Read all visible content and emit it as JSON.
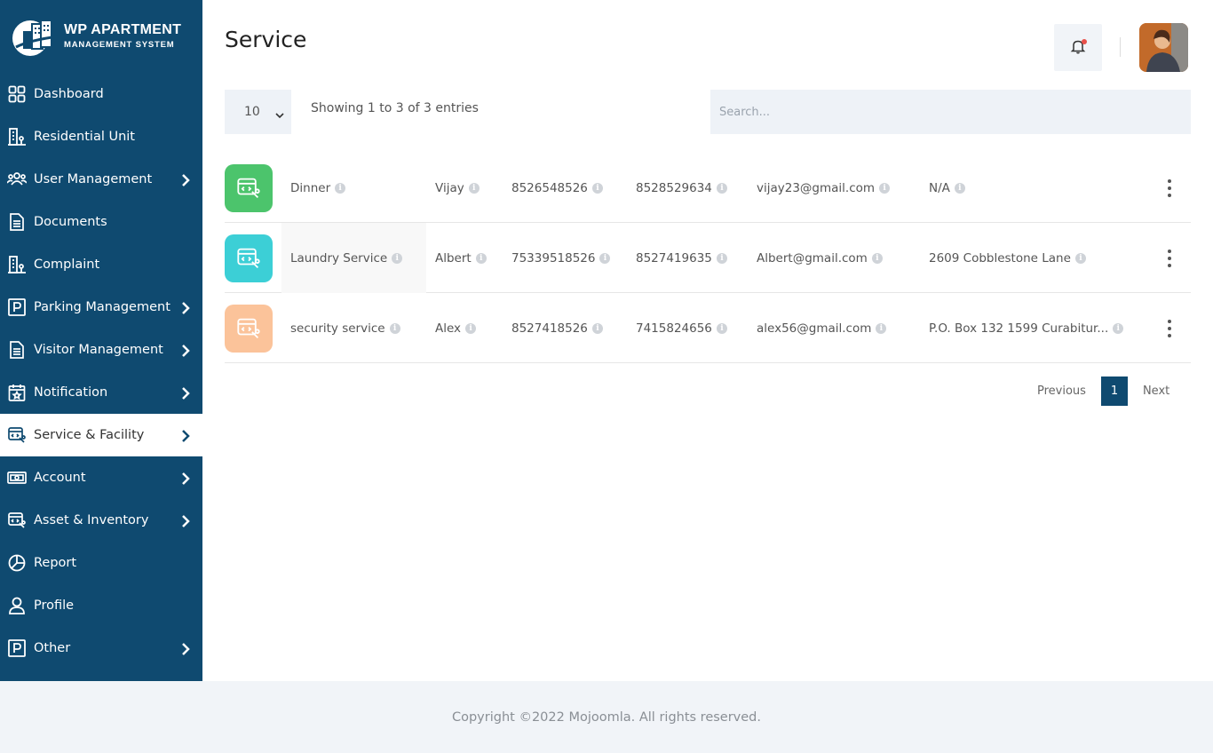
{
  "brand": {
    "title": "WP APARTMENT",
    "subtitle": "MANAGEMENT SYSTEM"
  },
  "sidebar": {
    "items": [
      {
        "label": "Dashboard",
        "icon": "grid-icon",
        "has_submenu": false
      },
      {
        "label": "Residential Unit",
        "icon": "building-icon",
        "has_submenu": false
      },
      {
        "label": "User Management",
        "icon": "users-icon",
        "has_submenu": true
      },
      {
        "label": "Documents",
        "icon": "document-icon",
        "has_submenu": false
      },
      {
        "label": "Complaint",
        "icon": "building-icon",
        "has_submenu": false
      },
      {
        "label": "Parking Management",
        "icon": "parking-icon",
        "has_submenu": true
      },
      {
        "label": "Visitor Management",
        "icon": "document-icon",
        "has_submenu": true
      },
      {
        "label": "Notification",
        "icon": "calendar-star-icon",
        "has_submenu": true
      },
      {
        "label": "Service & Facility",
        "icon": "service-icon",
        "has_submenu": true,
        "active": true
      },
      {
        "label": "Account",
        "icon": "money-icon",
        "has_submenu": true
      },
      {
        "label": "Asset & Inventory",
        "icon": "service-icon",
        "has_submenu": true
      },
      {
        "label": "Report",
        "icon": "pie-chart-icon",
        "has_submenu": false
      },
      {
        "label": "Profile",
        "icon": "user-icon",
        "has_submenu": false
      },
      {
        "label": "Other",
        "icon": "parking-icon",
        "has_submenu": true
      }
    ]
  },
  "header": {
    "title": "Service"
  },
  "table_controls": {
    "page_length": "10",
    "info": "Showing 1 to 3 of 3 entries",
    "search_placeholder": "Search..."
  },
  "rows": [
    {
      "service": "Dinner",
      "contact": "Vijay",
      "phone1": "8526548526",
      "phone2": "8528529634",
      "email": "vijay23@gmail.com",
      "address": "N/A",
      "icon_color": "#4cc46c"
    },
    {
      "service": "Laundry Service",
      "contact": "Albert",
      "phone1": "75339518526",
      "phone2": "8527419635",
      "email": "Albert@gmail.com",
      "address": "2609 Cobblestone Lane",
      "icon_color": "#3ccfd6"
    },
    {
      "service": "security service",
      "contact": "Alex",
      "phone1": "8527418526",
      "phone2": "7415824656",
      "email": "alex56@gmail.com",
      "address": "P.O. Box 132 1599 Curabitur...",
      "icon_color": "#fbc39a"
    }
  ],
  "pagination": {
    "previous": "Previous",
    "current": "1",
    "next": "Next"
  },
  "footer": {
    "copyright": "Copyright ©2022 Mojoomla. All rights reserved."
  },
  "colors": {
    "sidebar": "#0f4a70",
    "accent": "#0f4a70",
    "notification_dot": "#e8504a"
  }
}
